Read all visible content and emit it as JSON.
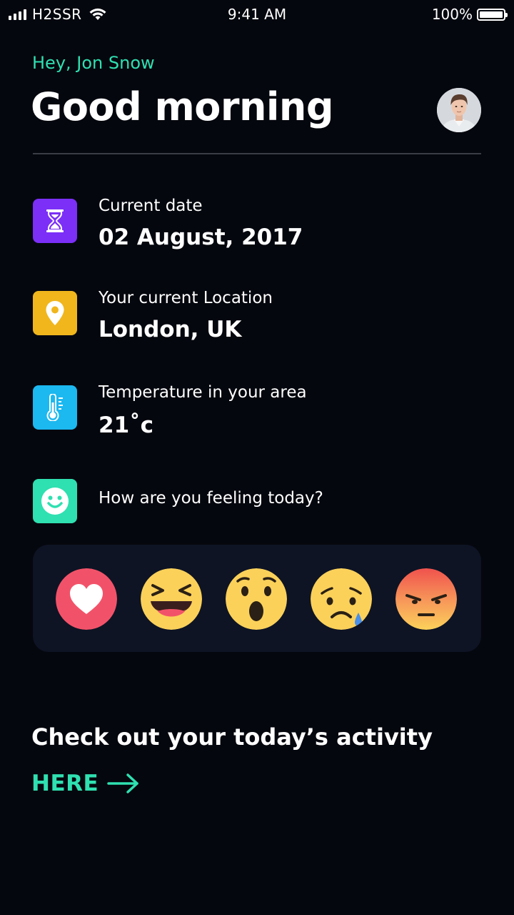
{
  "status_bar": {
    "carrier": "H2SSR",
    "time": "9:41 AM",
    "battery": "100%",
    "battery_level": 1.0,
    "signal_bars": 4
  },
  "header": {
    "greeting": "Hey, Jon Snow",
    "title": "Good morning"
  },
  "info": {
    "date": {
      "label": "Current date",
      "value": "02 August, 2017",
      "icon": "hourglass-icon",
      "color": "#7b2ff7"
    },
    "location": {
      "label": "Your current Location",
      "value": "London, UK",
      "icon": "location-pin-icon",
      "color": "#f0b61c"
    },
    "temperature": {
      "label": "Temperature in your area",
      "value": "21˚c",
      "icon": "thermometer-icon",
      "color": "#1cb8f0"
    },
    "feeling": {
      "label": "How are you feeling today?",
      "icon": "smiley-icon",
      "color": "#2fe0b0"
    }
  },
  "reactions": [
    "heart",
    "laughing",
    "surprised",
    "sad",
    "angry"
  ],
  "activity": {
    "text": "Check out your today’s activity",
    "link_label": "HERE",
    "accent": "#2fe0b0"
  }
}
